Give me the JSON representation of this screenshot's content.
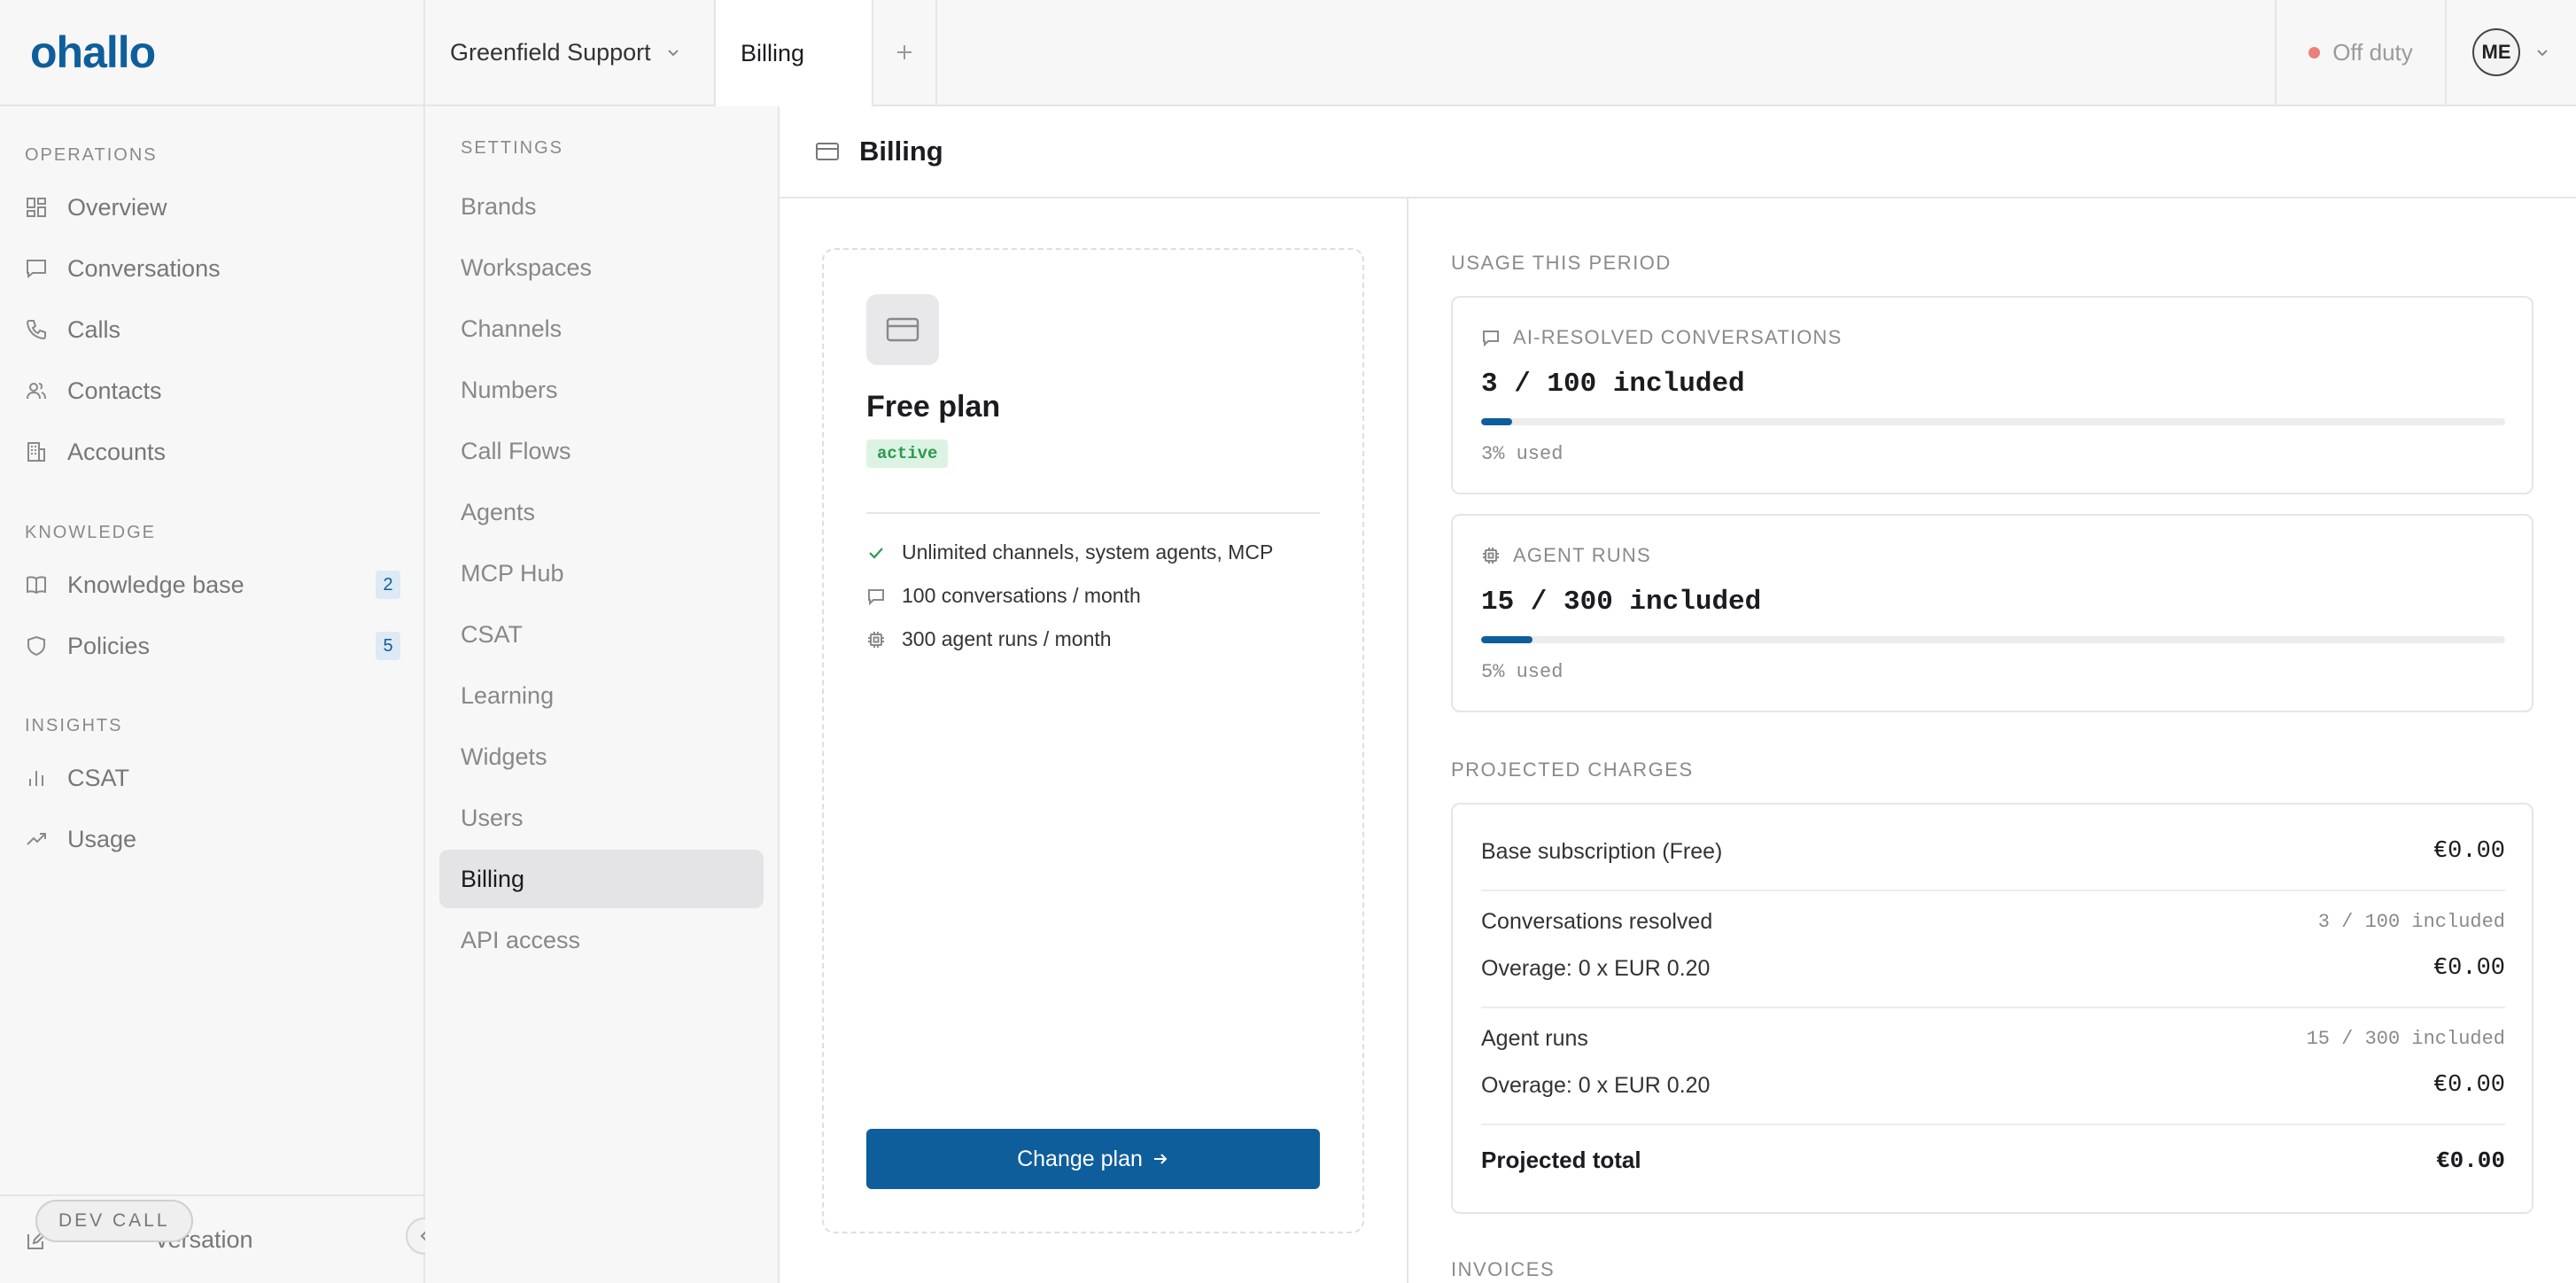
{
  "app": {
    "logo": "ohallo"
  },
  "topbar": {
    "workspace": "Greenfield Support",
    "active_tab": "Billing",
    "status": "Off duty",
    "avatar_initials": "ME"
  },
  "sidebar": {
    "sections": [
      {
        "title": "OPERATIONS"
      },
      {
        "title": "KNOWLEDGE"
      },
      {
        "title": "INSIGHTS"
      }
    ],
    "items": [
      {
        "label": "Overview"
      },
      {
        "label": "Conversations"
      },
      {
        "label": "Calls"
      },
      {
        "label": "Contacts"
      },
      {
        "label": "Accounts"
      },
      {
        "label": "Knowledge base",
        "count": "2"
      },
      {
        "label": "Policies",
        "count": "5"
      },
      {
        "label": "CSAT"
      },
      {
        "label": "Usage"
      }
    ],
    "bottom_label": "versation",
    "dev_call": "DEV CALL"
  },
  "settings": {
    "title": "SETTINGS",
    "items": [
      "Brands",
      "Workspaces",
      "Channels",
      "Numbers",
      "Call Flows",
      "Agents",
      "MCP Hub",
      "CSAT",
      "Learning",
      "Widgets",
      "Users",
      "Billing",
      "API access"
    ],
    "active": "Billing"
  },
  "page": {
    "title": "Billing"
  },
  "plan": {
    "name": "Free plan",
    "badge": "active",
    "features": [
      {
        "icon": "check-icon",
        "text": "Unlimited channels, system agents, MCP"
      },
      {
        "icon": "chat-icon",
        "text": "100 conversations / month"
      },
      {
        "icon": "chip-icon",
        "text": "300 agent runs / month"
      }
    ],
    "button": "Change plan"
  },
  "usage": {
    "title": "USAGE THIS PERIOD",
    "cards": [
      {
        "label": "AI-RESOLVED CONVERSATIONS",
        "value": "3 / 100 included",
        "fraction": 0.03,
        "pct_text": "3% used"
      },
      {
        "label": "AGENT RUNS",
        "value": "15 / 300 included",
        "fraction": 0.05,
        "pct_text": "5% used"
      }
    ]
  },
  "charges": {
    "title": "PROJECTED CHARGES",
    "base_label": "Base subscription (Free)",
    "base_amount": "€0.00",
    "conv_label": "Conversations resolved",
    "conv_note": "3 / 100 included",
    "conv_overage_label": "Overage: 0 x EUR 0.20",
    "conv_overage_amount": "€0.00",
    "runs_label": "Agent runs",
    "runs_note": "15 / 300 included",
    "runs_overage_label": "Overage: 0 x EUR 0.20",
    "runs_overage_amount": "€0.00",
    "total_label": "Projected total",
    "total_amount": "€0.00"
  },
  "invoices": {
    "title": "INVOICES"
  },
  "colors": {
    "accent": "#0f5e9c",
    "badge_bg": "#dcf3e3",
    "badge_text": "#2b9a4f",
    "off_duty_dot": "#e8827b"
  }
}
